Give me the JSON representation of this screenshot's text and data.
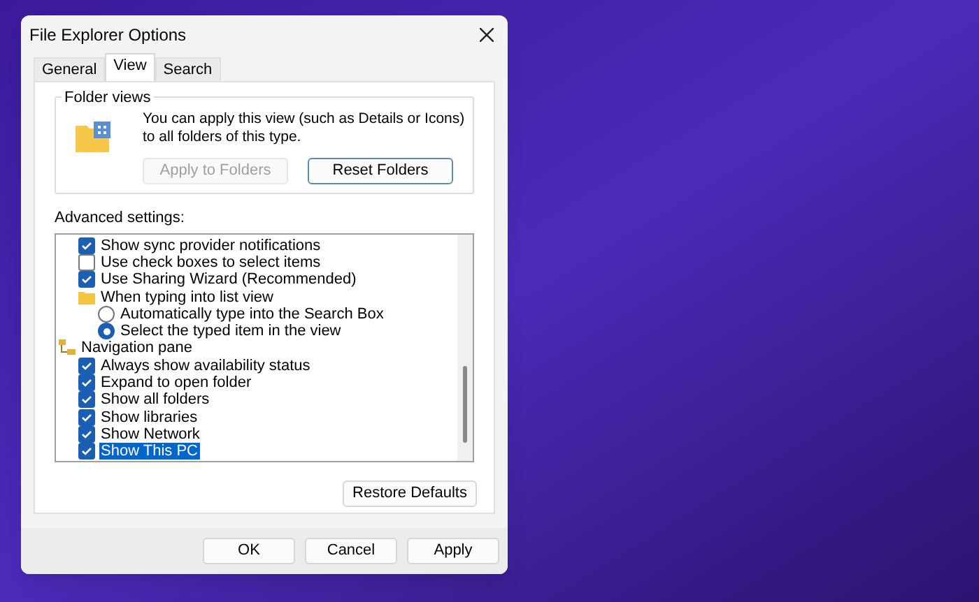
{
  "window": {
    "title": "File Explorer Options"
  },
  "tabs": [
    {
      "label": "General",
      "selected": false
    },
    {
      "label": "View",
      "selected": true
    },
    {
      "label": "Search",
      "selected": false
    }
  ],
  "folder_views": {
    "title": "Folder views",
    "description": "You can apply this view (such as Details or Icons) to all folders of this type.",
    "buttons": [
      {
        "label": "Apply to Folders",
        "disabled": true
      },
      {
        "label": "Reset Folders",
        "disabled": false
      }
    ]
  },
  "advanced_settings": {
    "label": "Advanced settings:",
    "items": [
      {
        "kind": "checkbox",
        "label": "Show sync provider notifications",
        "checked": true,
        "selected": false
      },
      {
        "kind": "checkbox",
        "label": "Use check boxes to select items",
        "checked": false,
        "selected": false
      },
      {
        "kind": "checkbox",
        "label": "Use Sharing Wizard (Recommended)",
        "checked": true,
        "selected": false
      },
      {
        "kind": "folder",
        "label": "When typing into list view",
        "selected": false,
        "children": [
          {
            "kind": "radio",
            "label": "Automatically type into the Search Box",
            "checked": false,
            "selected": false
          },
          {
            "kind": "radio",
            "label": "Select the typed item in the view",
            "checked": true,
            "selected": false
          }
        ]
      },
      {
        "kind": "group",
        "label": "Navigation pane",
        "selected": false,
        "children": [
          {
            "kind": "checkbox",
            "label": "Always show availability status",
            "checked": true,
            "selected": false
          },
          {
            "kind": "checkbox",
            "label": "Expand to open folder",
            "checked": true,
            "selected": false
          },
          {
            "kind": "checkbox",
            "label": "Show all folders",
            "checked": true,
            "selected": false
          },
          {
            "kind": "checkbox",
            "label": "Show libraries",
            "checked": true,
            "selected": false
          },
          {
            "kind": "checkbox",
            "label": "Show Network",
            "checked": true,
            "selected": false
          },
          {
            "kind": "checkbox",
            "label": "Show This PC",
            "checked": true,
            "selected": true
          }
        ]
      }
    ]
  },
  "restore_button": "Restore Defaults",
  "buttons": [
    "OK",
    "Cancel",
    "Apply"
  ]
}
